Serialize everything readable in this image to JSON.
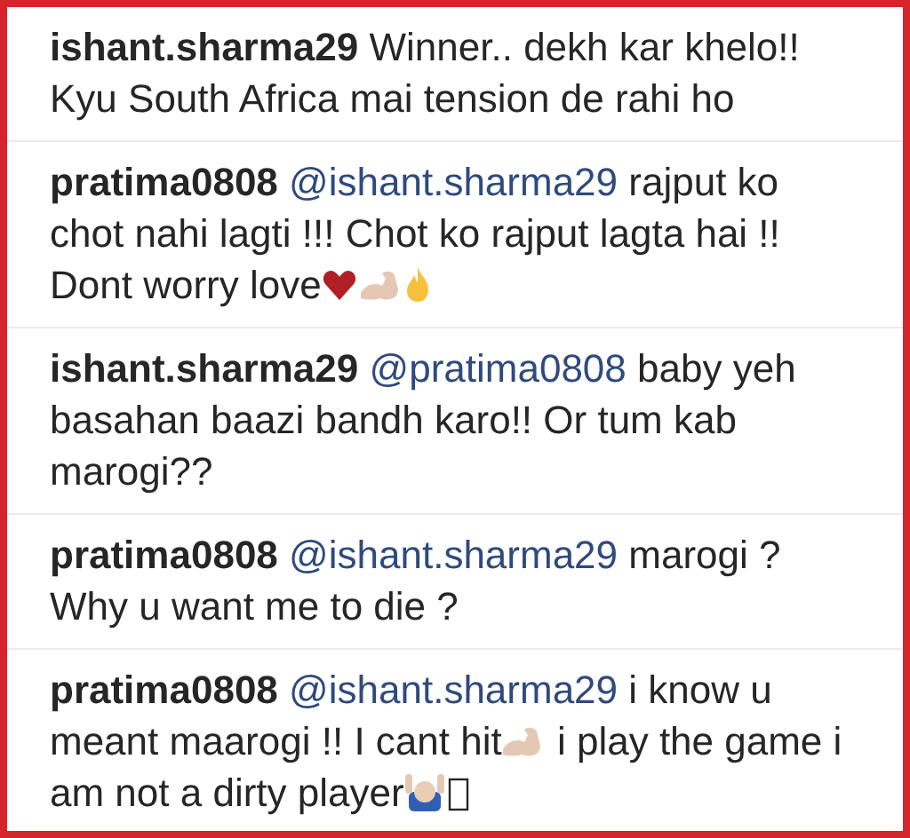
{
  "comments": [
    {
      "user": "ishant.sharma29",
      "parts": [
        "Winner.. dekh kar khelo!! Kyu South Africa mai tension de rahi ho"
      ]
    },
    {
      "user": "pratima0808",
      "mention": "@ishant.sharma29",
      "parts": [
        "rajput ko chot nahi lagti !!! Chot ko rajput lagta hai !! Dont worry love"
      ]
    },
    {
      "user": "ishant.sharma29",
      "mention": "@pratima0808",
      "parts": [
        "baby yeh basahan baazi bandh karo!! Or tum kab marogi??"
      ]
    },
    {
      "user": "pratima0808",
      "mention": "@ishant.sharma29",
      "parts": [
        "marogi ? Why u want me to die ?"
      ]
    },
    {
      "user": "pratima0808",
      "mention": "@ishant.sharma29",
      "parts": [
        "i know u meant maarogi !! I cant hit",
        "i play the game i am not a dirty player"
      ]
    }
  ]
}
